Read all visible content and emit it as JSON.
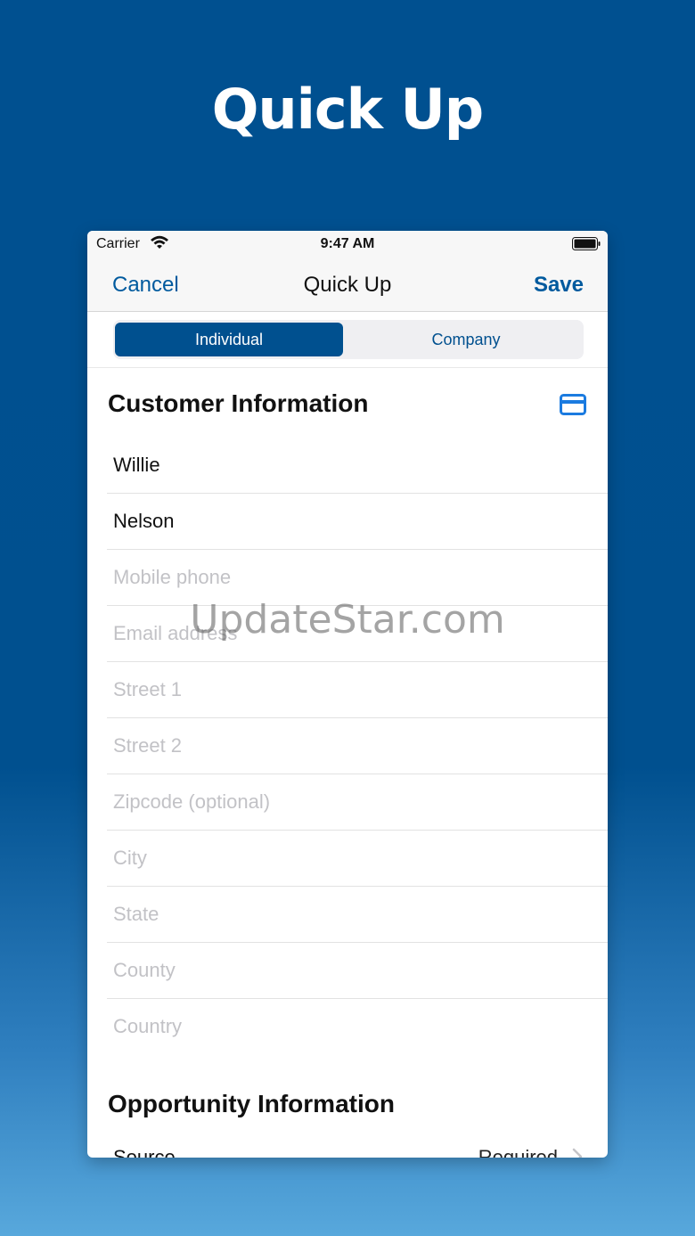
{
  "hero": {
    "title": "Quick Up"
  },
  "status_bar": {
    "carrier": "Carrier",
    "time": "9:47 AM"
  },
  "nav": {
    "cancel": "Cancel",
    "title": "Quick Up",
    "save": "Save"
  },
  "segments": {
    "selected": "Individual",
    "options": [
      "Individual",
      "Company"
    ]
  },
  "customer_section": {
    "title": "Customer Information",
    "icon": "credit-card-icon",
    "fields": [
      {
        "value": "Willie",
        "placeholder": ""
      },
      {
        "value": "Nelson",
        "placeholder": ""
      },
      {
        "value": "",
        "placeholder": "Mobile phone"
      },
      {
        "value": "",
        "placeholder": "Email address"
      },
      {
        "value": "",
        "placeholder": "Street 1"
      },
      {
        "value": "",
        "placeholder": "Street 2"
      },
      {
        "value": "",
        "placeholder": "Zipcode (optional)"
      },
      {
        "value": "",
        "placeholder": "City"
      },
      {
        "value": "",
        "placeholder": "State"
      },
      {
        "value": "",
        "placeholder": "County"
      },
      {
        "value": "",
        "placeholder": "Country"
      }
    ]
  },
  "opportunity_section": {
    "title": "Opportunity Information",
    "source_label": "Source",
    "source_value": "Required"
  },
  "watermark": "UpdateStar.com",
  "colors": {
    "brand": "#00508f",
    "accent_icon": "#1b7be0",
    "background": "#005090"
  }
}
